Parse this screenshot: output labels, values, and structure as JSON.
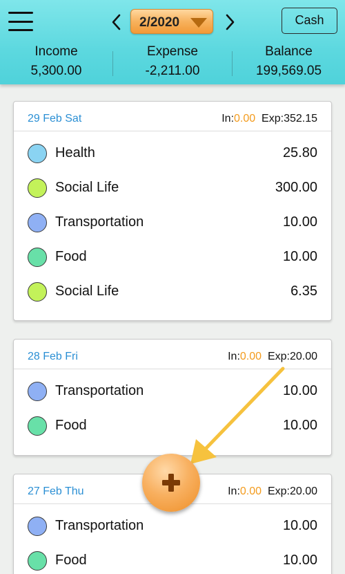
{
  "header": {
    "menu_icon": "hamburger-menu-icon",
    "prev_icon": "chevron-left-icon",
    "next_icon": "chevron-right-icon",
    "month": "2/2020",
    "month_caret_icon": "caret-down-icon",
    "account_button": "Cash",
    "accent_color": "#5cd8df"
  },
  "summary": {
    "income_label": "Income",
    "income_value": "5,300.00",
    "expense_label": "Expense",
    "expense_value": "-2,211.00",
    "balance_label": "Balance",
    "balance_value": "199,569.05"
  },
  "days": [
    {
      "date": "29 Feb Sat",
      "in_label": "In:",
      "in_value": "0.00",
      "exp_label": "Exp:",
      "exp_value": "352.15",
      "items": [
        {
          "category": "Health",
          "amount": "25.80",
          "color": "#8ad3f2"
        },
        {
          "category": "Social Life",
          "amount": "300.00",
          "color": "#c3f25a"
        },
        {
          "category": "Transportation",
          "amount": "10.00",
          "color": "#8fb0f4"
        },
        {
          "category": "Food",
          "amount": "10.00",
          "color": "#68e0a8"
        },
        {
          "category": "Social Life",
          "amount": "6.35",
          "color": "#c3f25a"
        }
      ]
    },
    {
      "date": "28 Feb Fri",
      "in_label": "In:",
      "in_value": "0.00",
      "exp_label": "Exp:",
      "exp_value": "20.00",
      "items": [
        {
          "category": "Transportation",
          "amount": "10.00",
          "color": "#8fb0f4"
        },
        {
          "category": "Food",
          "amount": "10.00",
          "color": "#68e0a8"
        }
      ]
    },
    {
      "date": "27 Feb Thu",
      "in_label": "In:",
      "in_value": "0.00",
      "exp_label": "Exp:",
      "exp_value": "20.00",
      "items": [
        {
          "category": "Transportation",
          "amount": "10.00",
          "color": "#8fb0f4"
        },
        {
          "category": "Food",
          "amount": "10.00",
          "color": "#68e0a8"
        }
      ]
    }
  ],
  "fab": {
    "icon": "plus-icon",
    "color": "#f5a44a"
  },
  "annotation": {
    "icon": "arrow-pointer-icon",
    "color": "#f6c23e"
  }
}
